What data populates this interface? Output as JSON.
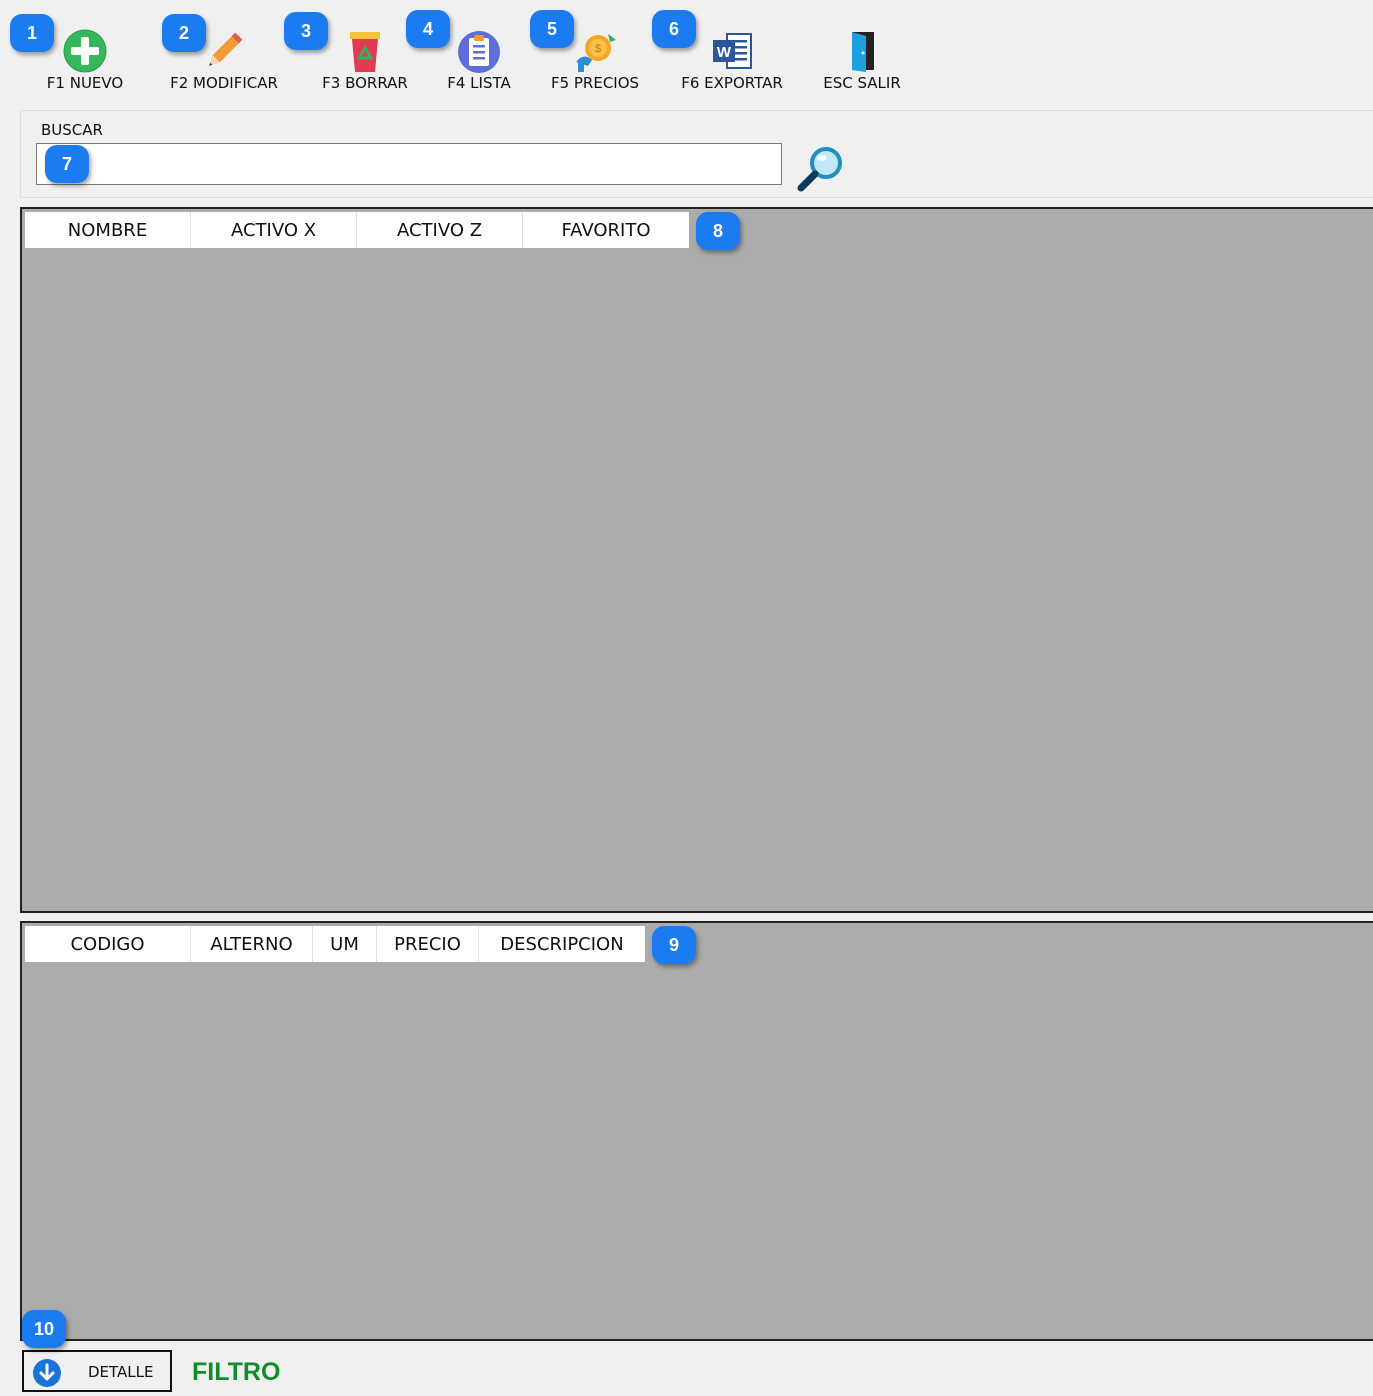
{
  "toolbar": {
    "items": [
      {
        "label": "F1 NUEVO",
        "badge": "1",
        "icon": "plus-circle-icon"
      },
      {
        "label": "F2 MODIFICAR",
        "badge": "2",
        "icon": "pencil-icon"
      },
      {
        "label": "F3 BORRAR",
        "badge": "3",
        "icon": "recycle-bin-icon"
      },
      {
        "label": "F4 LISTA",
        "badge": "4",
        "icon": "clipboard-list-icon"
      },
      {
        "label": "F5 PRECIOS",
        "badge": "5",
        "icon": "price-coin-icon"
      },
      {
        "label": "F6 EXPORTAR",
        "badge": "6",
        "icon": "word-document-icon"
      },
      {
        "label": "ESC SALIR",
        "icon": "exit-door-icon"
      }
    ]
  },
  "search": {
    "label": "BUSCAR",
    "value": "",
    "badge": "7",
    "button_icon": "magnifier-icon"
  },
  "main_grid": {
    "badge": "8",
    "columns": [
      "NOMBRE",
      "ACTIVO X",
      "ACTIVO Z",
      "FAVORITO"
    ],
    "rows": []
  },
  "detail_grid": {
    "badge": "9",
    "columns": [
      "CODIGO",
      "ALTERNO",
      "UM",
      "PRECIO",
      "DESCRIPCION"
    ],
    "rows": []
  },
  "footer": {
    "badge": "10",
    "detalle_label": "DETALLE",
    "detalle_icon": "arrow-down-circle-icon",
    "filtro_label": "FILTRO"
  },
  "colors": {
    "badge": "#1a7cf0",
    "grid_bg": "#ababab",
    "filtro": "#128c2a",
    "window_bg": "#f0f0f0"
  }
}
